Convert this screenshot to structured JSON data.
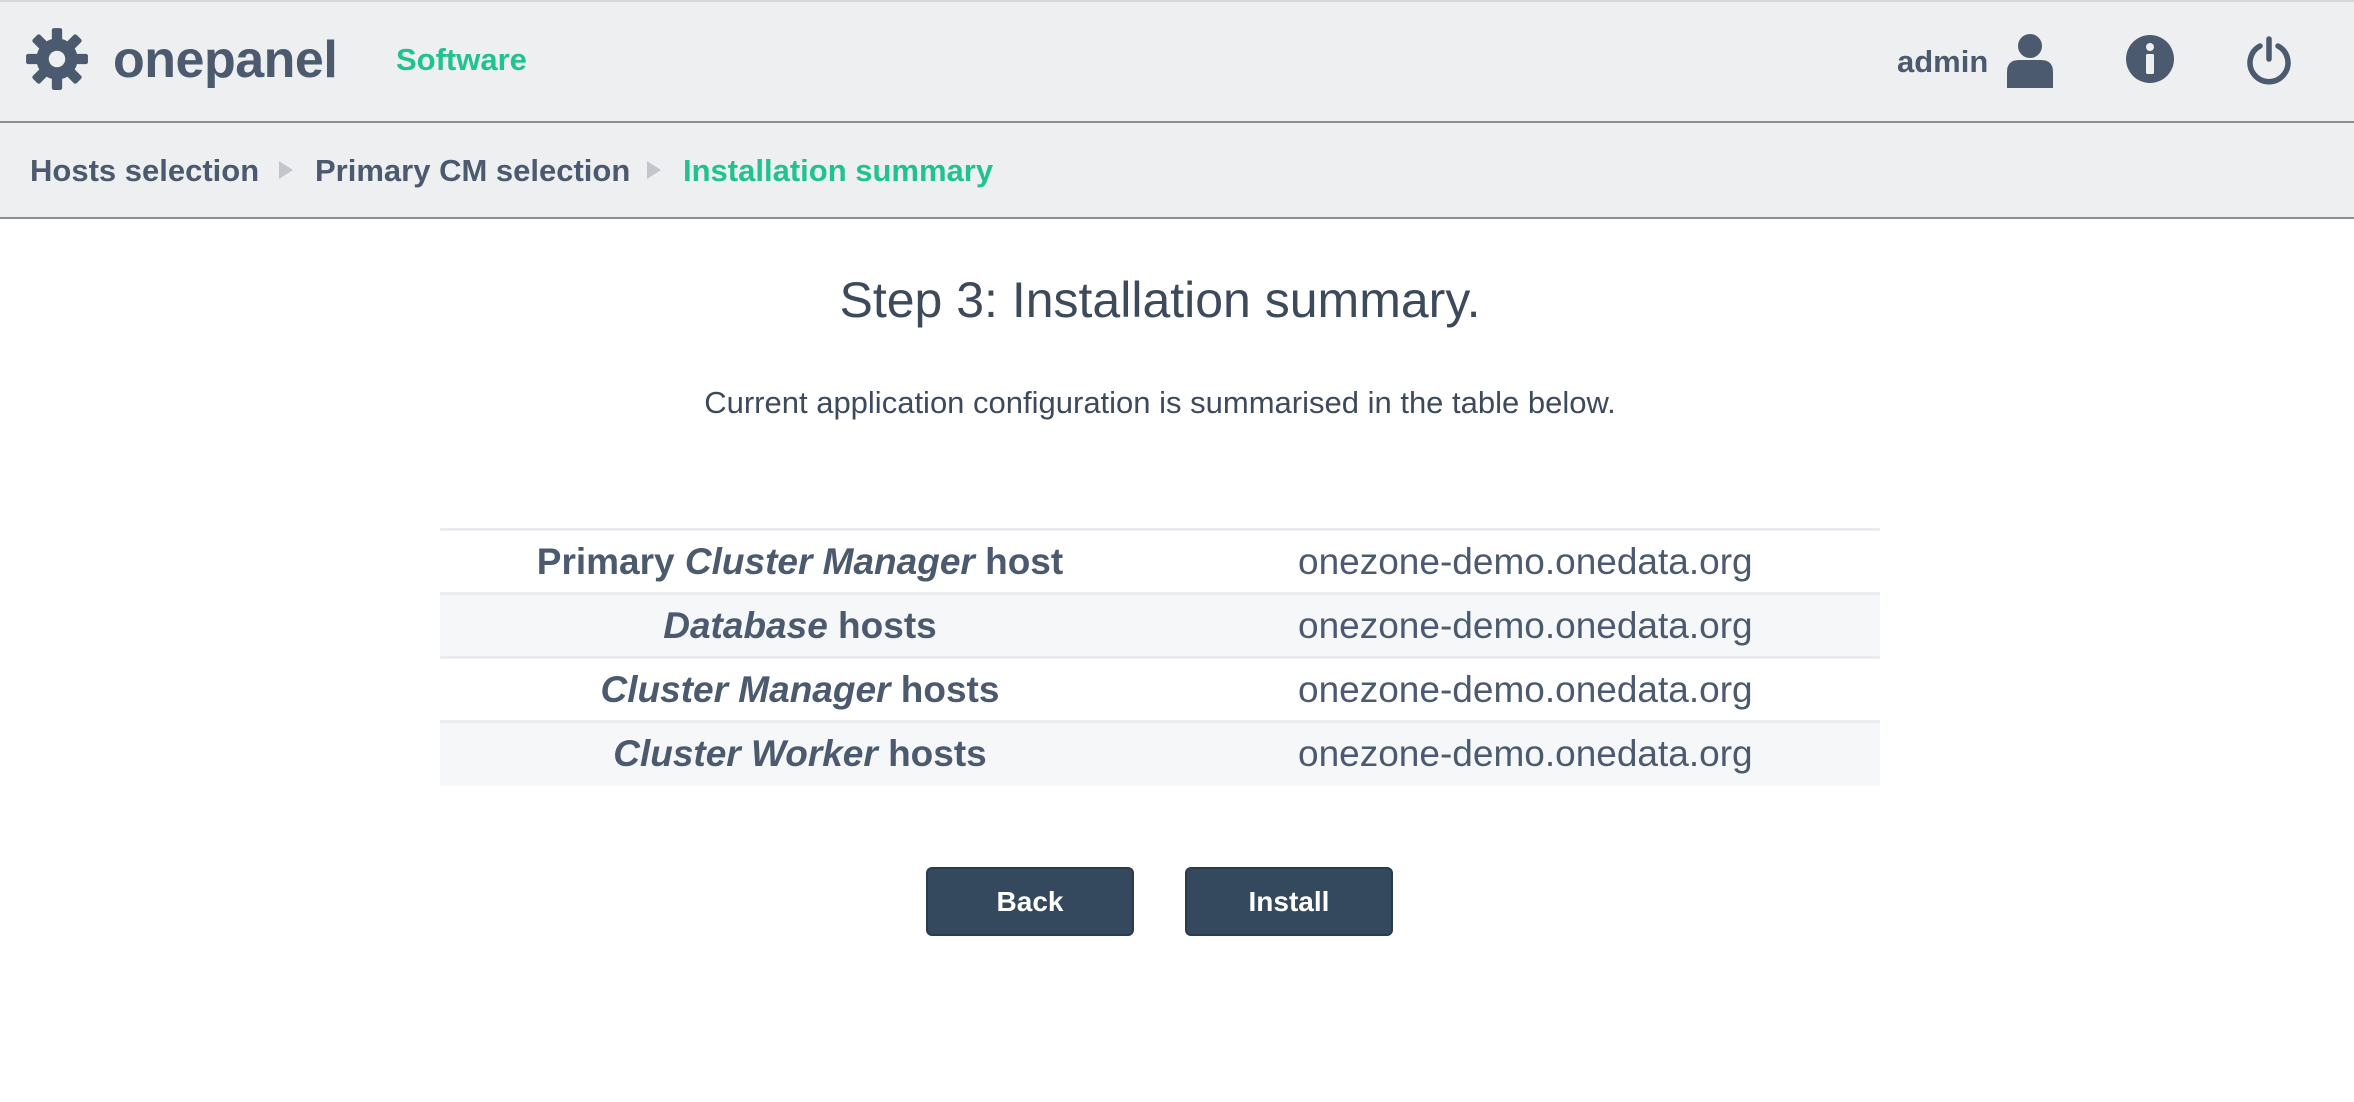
{
  "header": {
    "app_name": "onepanel",
    "nav_software": "Software",
    "username": "admin",
    "icons": {
      "logo": "gear-icon",
      "user": "user-icon",
      "info": "info-icon",
      "logout": "power-icon"
    }
  },
  "breadcrumb": {
    "steps": [
      {
        "label": "Hosts selection"
      },
      {
        "label": "Primary CM selection"
      },
      {
        "label": "Installation summary"
      }
    ]
  },
  "main": {
    "title": "Step 3: Installation summary.",
    "description": "Current application configuration is summarised in the table below.",
    "rows": [
      {
        "prefix": "Primary ",
        "emphasis": "Cluster Manager",
        "suffix": " host",
        "value": "onezone-demo.onedata.org"
      },
      {
        "prefix": "",
        "emphasis": "Database",
        "suffix": " hosts",
        "value": "onezone-demo.onedata.org"
      },
      {
        "prefix": "",
        "emphasis": "Cluster Manager",
        "suffix": " hosts",
        "value": "onezone-demo.onedata.org"
      },
      {
        "prefix": "",
        "emphasis": "Cluster Worker",
        "suffix": " hosts",
        "value": "onezone-demo.onedata.org"
      }
    ],
    "back_label": "Back",
    "install_label": "Install"
  },
  "colors": {
    "accent": "#20c28f",
    "text": "#4b5a6e",
    "button": "#34495e",
    "bar_bg": "#eeeff1"
  }
}
